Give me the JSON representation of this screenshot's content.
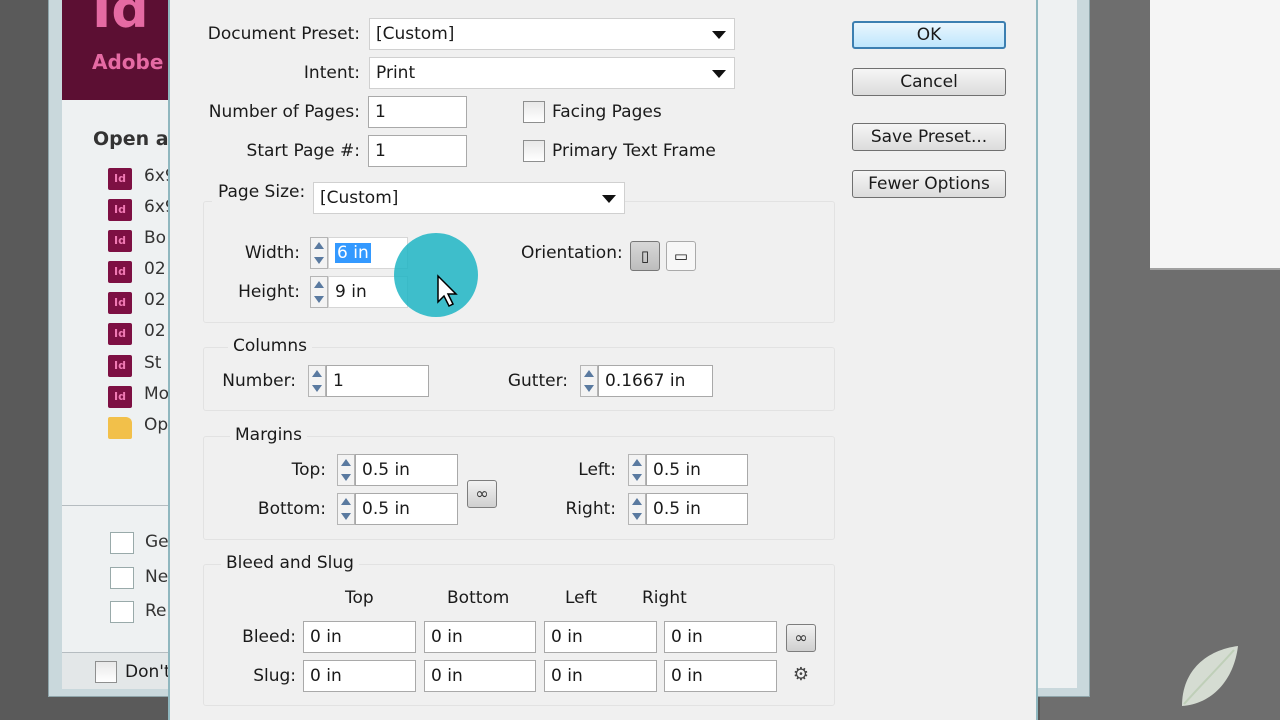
{
  "welcome": {
    "logo": "Id",
    "brand": "Adobe",
    "open_heading": "Open a",
    "recent": [
      "6x9",
      "6x9",
      "Bo",
      "02",
      "02",
      "02",
      "St",
      "Mo"
    ],
    "open_label": "Op",
    "bottom_items": [
      "Ge",
      "Ne",
      "Re"
    ],
    "dont_show": "Don't"
  },
  "dialog": {
    "document_preset": {
      "label": "Document Preset:",
      "value": "[Custom]"
    },
    "intent": {
      "label": "Intent:",
      "value": "Print"
    },
    "number_of_pages": {
      "label": "Number of Pages:",
      "value": "1"
    },
    "start_page": {
      "label": "Start Page #:",
      "value": "1"
    },
    "facing_pages": {
      "label": "Facing Pages",
      "checked": false
    },
    "primary_text_frame": {
      "label": "Primary Text Frame",
      "checked": false
    },
    "page_size": {
      "label": "Page Size:",
      "value": "[Custom]"
    },
    "width": {
      "label": "Width:",
      "value": "6 in"
    },
    "height": {
      "label": "Height:",
      "value": "9 in"
    },
    "orientation": {
      "label": "Orientation:"
    },
    "columns": {
      "heading": "Columns",
      "number": {
        "label": "Number:",
        "value": "1"
      },
      "gutter": {
        "label": "Gutter:",
        "value": "0.1667 in"
      }
    },
    "margins": {
      "heading": "Margins",
      "top": {
        "label": "Top:",
        "value": "0.5 in"
      },
      "bottom": {
        "label": "Bottom:",
        "value": "0.5 in"
      },
      "left": {
        "label": "Left:",
        "value": "0.5 in"
      },
      "right": {
        "label": "Right:",
        "value": "0.5 in"
      }
    },
    "bleed_slug": {
      "heading": "Bleed and Slug",
      "columns": [
        "Top",
        "Bottom",
        "Left",
        "Right"
      ],
      "bleed_label": "Bleed:",
      "slug_label": "Slug:",
      "bleed": [
        "0 in",
        "0 in",
        "0 in",
        "0 in"
      ],
      "slug": [
        "0 in",
        "0 in",
        "0 in",
        "0 in"
      ]
    },
    "buttons": {
      "ok": "OK",
      "cancel": "Cancel",
      "save_preset": "Save Preset...",
      "fewer_options": "Fewer Options"
    }
  },
  "colors": {
    "cursor_highlight": "#1fb5c4",
    "selection": "#3399ff",
    "default_button_border": "#3c7fb1"
  }
}
